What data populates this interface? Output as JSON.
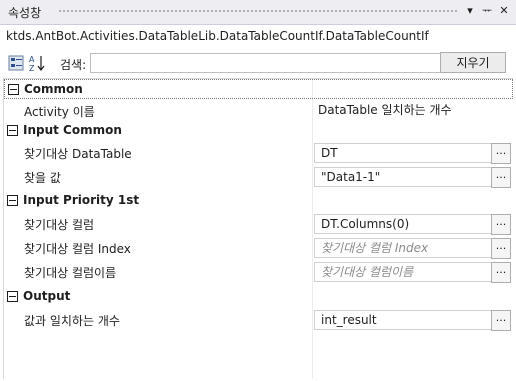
{
  "window": {
    "title": "속성창",
    "buttons": [
      "▾",
      "ᅲ",
      "✕"
    ]
  },
  "type_name": "ktds.AntBot.Activities.DataTableLib.DataTableCountIf.DataTableCountIf",
  "toolbar": {
    "search_label": "검색:",
    "search_value": "",
    "clear_label": "지우기"
  },
  "categories": [
    {
      "name": "Common",
      "properties": [
        {
          "name": "Activity 이름",
          "value": "DataTable 일치하는 개수",
          "placeholder": false,
          "has_button": false
        }
      ]
    },
    {
      "name": "Input Common",
      "properties": [
        {
          "name": "찾기대상 DataTable",
          "value": "DT",
          "placeholder": false,
          "has_button": true
        },
        {
          "name": "찾을 값",
          "value": "\"Data1-1\"",
          "placeholder": false,
          "has_button": true
        }
      ]
    },
    {
      "name": "Input Priority 1st",
      "properties": [
        {
          "name": "찾기대상 컬럼",
          "value": "DT.Columns(0)",
          "placeholder": false,
          "has_button": true
        },
        {
          "name": "찾기대상 컬럼 Index",
          "value": "찾기대상 컬럼 Index",
          "placeholder": true,
          "has_button": true
        },
        {
          "name": "찾기대상 컬럼이름",
          "value": "찾기대상 컬럼이름",
          "placeholder": true,
          "has_button": true
        }
      ]
    },
    {
      "name": "Output",
      "properties": [
        {
          "name": "값과 일치하는 개수",
          "value": "int_result",
          "placeholder": false,
          "has_button": true
        }
      ]
    }
  ],
  "ellipsis_label": "..."
}
